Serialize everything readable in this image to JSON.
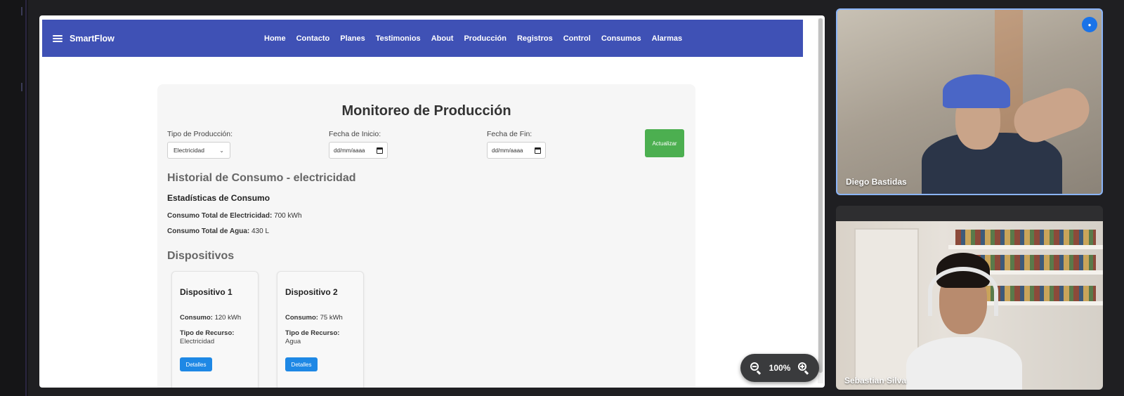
{
  "browser_page": {
    "navbar": {
      "brand": "SmartFlow",
      "links": [
        "Home",
        "Contacto",
        "Planes",
        "Testimonios",
        "About",
        "Producción",
        "Registros",
        "Control",
        "Consumos",
        "Alarmas"
      ]
    },
    "monitor": {
      "title": "Monitoreo de Producción",
      "type_label": "Tipo de Producción:",
      "type_value": "Electricidad",
      "start_label": "Fecha de Inicio:",
      "start_value": "dd/mm/aaaa",
      "end_label": "Fecha de Fin:",
      "end_value": "dd/mm/aaaa",
      "update_button": "Actualizar",
      "history_title": "Historial de Consumo - electricidad",
      "stats_title": "Estadísticas de Consumo",
      "elec_label": "Consumo Total de Electricidad:",
      "elec_value": "700 kWh",
      "water_label": "Consumo Total de Agua:",
      "water_value": "430 L",
      "devices_title": "Dispositivos",
      "devices": [
        {
          "name": "Dispositivo 1",
          "consumo_label": "Consumo:",
          "consumo": "120 kWh",
          "resource_label": "Tipo de Recurso:",
          "resource": "Electricidad",
          "button": "Detalles"
        },
        {
          "name": "Dispositivo 2",
          "consumo_label": "Consumo:",
          "consumo": "75 kWh",
          "resource_label": "Tipo de Recurso:",
          "resource": "Agua",
          "button": "Detalles"
        }
      ]
    }
  },
  "zoom": {
    "level": "100%"
  },
  "participants": [
    {
      "name": "Diego Bastidas"
    },
    {
      "name": "Sebastian Silva"
    }
  ],
  "colors": {
    "navbar": "#3f51b5",
    "update_button": "#4caf50",
    "detail_button": "#1e88e5",
    "active_speaker_border": "#8ab4f8"
  }
}
